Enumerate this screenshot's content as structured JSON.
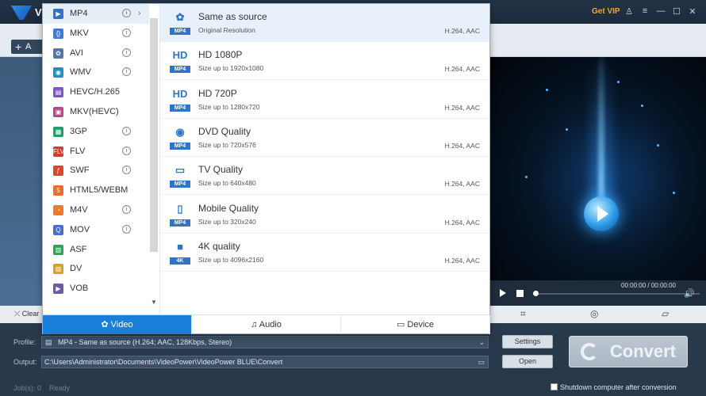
{
  "app": {
    "logo_letter": "V",
    "get_vip": "Get VIP"
  },
  "toolbar": {
    "add_label": "A"
  },
  "bottom": {
    "clear_label": "Clear"
  },
  "player": {
    "time": "00:00:00 / 00:00:00",
    "progress": 0
  },
  "profile": {
    "label": "Profile:",
    "value": "MP4 - Same as source (H.264; AAC, 128Kbps, Stereo)",
    "settings_button": "Settings"
  },
  "output": {
    "label": "Output:",
    "value": "C:\\Users\\Administrator\\Documents\\VideoPower\\VideoPower BLUE\\Convert",
    "open_button": "Open"
  },
  "convert_button": "Convert",
  "status": {
    "jobs": "Job(s): 0",
    "state": "Ready"
  },
  "shutdown_label": "Shutdown computer after conversion",
  "format_list": [
    {
      "label": "MP4",
      "color": "#2f74c8",
      "glyph": "▶",
      "info": true,
      "active": true
    },
    {
      "label": "MKV",
      "color": "#3c7bd6",
      "glyph": "{}",
      "info": true
    },
    {
      "label": "AVI",
      "color": "#5577a8",
      "glyph": "✿",
      "info": true
    },
    {
      "label": "WMV",
      "color": "#1a93c4",
      "glyph": "◉",
      "info": true
    },
    {
      "label": "HEVC/H.265",
      "color": "#7a56c2",
      "glyph": "▤",
      "info": false
    },
    {
      "label": "MKV(HEVC)",
      "color": "#c0428a",
      "glyph": "▣",
      "info": false
    },
    {
      "label": "3GP",
      "color": "#1f9e6e",
      "glyph": "▦",
      "info": true
    },
    {
      "label": "FLV",
      "color": "#d33b2f",
      "glyph": "FLV",
      "info": true
    },
    {
      "label": "SWF",
      "color": "#e0452a",
      "glyph": "ƒ",
      "info": true
    },
    {
      "label": "HTML5/WEBM",
      "color": "#ef6a2c",
      "glyph": "5",
      "info": false
    },
    {
      "label": "M4V",
      "color": "#f07a2a",
      "glyph": "◔",
      "info": true
    },
    {
      "label": "MOV",
      "color": "#4a6fc4",
      "glyph": "Q",
      "info": true
    },
    {
      "label": "ASF",
      "color": "#29a65a",
      "glyph": "▥",
      "info": false
    },
    {
      "label": "DV",
      "color": "#d7a21c",
      "glyph": "▨",
      "info": false
    },
    {
      "label": "VOB",
      "color": "#6c5aa8",
      "glyph": "▶",
      "info": false
    }
  ],
  "presets": [
    {
      "title": "Same as source",
      "sub": "Original Resolution",
      "codec": "H.264, AAC",
      "glyph": "✿",
      "tag": "MP4",
      "active": true
    },
    {
      "title": "HD 1080P",
      "sub": "Size up to 1920x1080",
      "codec": "H.264, AAC",
      "glyph": "HD",
      "tag": "MP4"
    },
    {
      "title": "HD 720P",
      "sub": "Size up to 1280x720",
      "codec": "H.264, AAC",
      "glyph": "HD",
      "tag": "MP4"
    },
    {
      "title": "DVD Quality",
      "sub": "Size up to 720x576",
      "codec": "H.264, AAC",
      "glyph": "◉",
      "tag": "MP4"
    },
    {
      "title": "TV Quality",
      "sub": "Size up to 640x480",
      "codec": "H.264, AAC",
      "glyph": "▭",
      "tag": "MP4"
    },
    {
      "title": "Mobile Quality",
      "sub": "Size up to 320x240",
      "codec": "H.264, AAC",
      "glyph": "▯",
      "tag": "MP4"
    },
    {
      "title": "4K quality",
      "sub": "Size up to 4096x2160",
      "codec": "H.264, AAC",
      "glyph": "■",
      "tag": "4K"
    }
  ],
  "tabs": [
    {
      "label": "Video",
      "icon": "film-reel-icon",
      "active": true
    },
    {
      "label": "Audio",
      "icon": "headphones-icon"
    },
    {
      "label": "Device",
      "icon": "devices-icon"
    }
  ]
}
